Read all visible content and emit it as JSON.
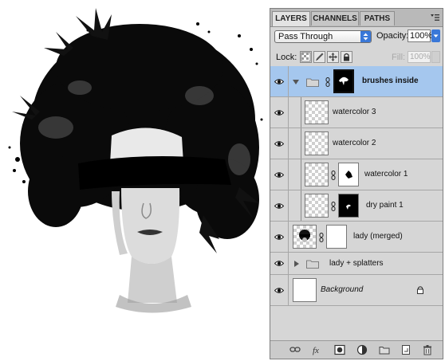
{
  "tabs": {
    "layers": "LAYERS",
    "channels": "CHANNELS",
    "paths": "PATHS"
  },
  "blend_mode": "Pass Through",
  "opacity": {
    "label": "Opacity:",
    "value": "100%"
  },
  "lock": {
    "label": "Lock:"
  },
  "fill": {
    "label": "Fill:",
    "value": "100%"
  },
  "layers": [
    {
      "name": "brushes inside",
      "kind": "group",
      "expanded": true,
      "selected": true,
      "visible": true
    },
    {
      "name": "watercolor 3",
      "kind": "layer",
      "visible": true
    },
    {
      "name": "watercolor 2",
      "kind": "layer",
      "visible": true
    },
    {
      "name": "watercolor 1",
      "kind": "layer",
      "visible": true
    },
    {
      "name": "dry paint 1",
      "kind": "layer",
      "visible": true
    },
    {
      "name": "lady (merged)",
      "kind": "layer",
      "visible": true
    },
    {
      "name": "lady + splatters",
      "kind": "group",
      "expanded": false,
      "visible": true
    },
    {
      "name": "Background",
      "kind": "background",
      "locked": true,
      "visible": true
    }
  ],
  "colors": {
    "selection": "#a5c7ee",
    "panel": "#d6d6d6",
    "accent": "#3a78d8"
  },
  "icons": {
    "visibility": "eye-icon",
    "link": "chain-link-icon",
    "group": "folder-icon",
    "disclosure": "triangle-icon",
    "lock": "padlock-icon",
    "bottom": [
      "link-layers-icon",
      "fx-icon",
      "add-mask-icon",
      "adjustment-layer-icon",
      "new-group-icon",
      "new-layer-icon",
      "trash-icon"
    ]
  }
}
